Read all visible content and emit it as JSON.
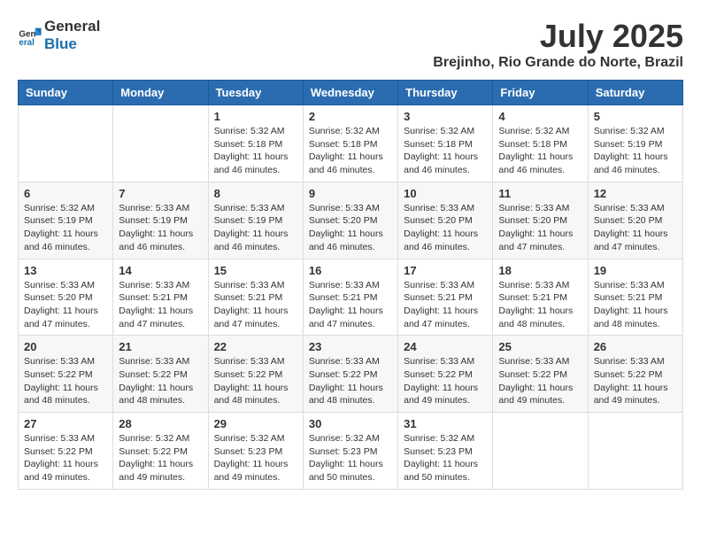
{
  "header": {
    "logo_general": "General",
    "logo_blue": "Blue",
    "title": "July 2025",
    "subtitle": "Brejinho, Rio Grande do Norte, Brazil"
  },
  "days_of_week": [
    "Sunday",
    "Monday",
    "Tuesday",
    "Wednesday",
    "Thursday",
    "Friday",
    "Saturday"
  ],
  "weeks": [
    [
      {
        "day": "",
        "info": ""
      },
      {
        "day": "",
        "info": ""
      },
      {
        "day": "1",
        "info": "Sunrise: 5:32 AM\nSunset: 5:18 PM\nDaylight: 11 hours and 46 minutes."
      },
      {
        "day": "2",
        "info": "Sunrise: 5:32 AM\nSunset: 5:18 PM\nDaylight: 11 hours and 46 minutes."
      },
      {
        "day": "3",
        "info": "Sunrise: 5:32 AM\nSunset: 5:18 PM\nDaylight: 11 hours and 46 minutes."
      },
      {
        "day": "4",
        "info": "Sunrise: 5:32 AM\nSunset: 5:18 PM\nDaylight: 11 hours and 46 minutes."
      },
      {
        "day": "5",
        "info": "Sunrise: 5:32 AM\nSunset: 5:19 PM\nDaylight: 11 hours and 46 minutes."
      }
    ],
    [
      {
        "day": "6",
        "info": "Sunrise: 5:32 AM\nSunset: 5:19 PM\nDaylight: 11 hours and 46 minutes."
      },
      {
        "day": "7",
        "info": "Sunrise: 5:33 AM\nSunset: 5:19 PM\nDaylight: 11 hours and 46 minutes."
      },
      {
        "day": "8",
        "info": "Sunrise: 5:33 AM\nSunset: 5:19 PM\nDaylight: 11 hours and 46 minutes."
      },
      {
        "day": "9",
        "info": "Sunrise: 5:33 AM\nSunset: 5:20 PM\nDaylight: 11 hours and 46 minutes."
      },
      {
        "day": "10",
        "info": "Sunrise: 5:33 AM\nSunset: 5:20 PM\nDaylight: 11 hours and 46 minutes."
      },
      {
        "day": "11",
        "info": "Sunrise: 5:33 AM\nSunset: 5:20 PM\nDaylight: 11 hours and 47 minutes."
      },
      {
        "day": "12",
        "info": "Sunrise: 5:33 AM\nSunset: 5:20 PM\nDaylight: 11 hours and 47 minutes."
      }
    ],
    [
      {
        "day": "13",
        "info": "Sunrise: 5:33 AM\nSunset: 5:20 PM\nDaylight: 11 hours and 47 minutes."
      },
      {
        "day": "14",
        "info": "Sunrise: 5:33 AM\nSunset: 5:21 PM\nDaylight: 11 hours and 47 minutes."
      },
      {
        "day": "15",
        "info": "Sunrise: 5:33 AM\nSunset: 5:21 PM\nDaylight: 11 hours and 47 minutes."
      },
      {
        "day": "16",
        "info": "Sunrise: 5:33 AM\nSunset: 5:21 PM\nDaylight: 11 hours and 47 minutes."
      },
      {
        "day": "17",
        "info": "Sunrise: 5:33 AM\nSunset: 5:21 PM\nDaylight: 11 hours and 47 minutes."
      },
      {
        "day": "18",
        "info": "Sunrise: 5:33 AM\nSunset: 5:21 PM\nDaylight: 11 hours and 48 minutes."
      },
      {
        "day": "19",
        "info": "Sunrise: 5:33 AM\nSunset: 5:21 PM\nDaylight: 11 hours and 48 minutes."
      }
    ],
    [
      {
        "day": "20",
        "info": "Sunrise: 5:33 AM\nSunset: 5:22 PM\nDaylight: 11 hours and 48 minutes."
      },
      {
        "day": "21",
        "info": "Sunrise: 5:33 AM\nSunset: 5:22 PM\nDaylight: 11 hours and 48 minutes."
      },
      {
        "day": "22",
        "info": "Sunrise: 5:33 AM\nSunset: 5:22 PM\nDaylight: 11 hours and 48 minutes."
      },
      {
        "day": "23",
        "info": "Sunrise: 5:33 AM\nSunset: 5:22 PM\nDaylight: 11 hours and 48 minutes."
      },
      {
        "day": "24",
        "info": "Sunrise: 5:33 AM\nSunset: 5:22 PM\nDaylight: 11 hours and 49 minutes."
      },
      {
        "day": "25",
        "info": "Sunrise: 5:33 AM\nSunset: 5:22 PM\nDaylight: 11 hours and 49 minutes."
      },
      {
        "day": "26",
        "info": "Sunrise: 5:33 AM\nSunset: 5:22 PM\nDaylight: 11 hours and 49 minutes."
      }
    ],
    [
      {
        "day": "27",
        "info": "Sunrise: 5:33 AM\nSunset: 5:22 PM\nDaylight: 11 hours and 49 minutes."
      },
      {
        "day": "28",
        "info": "Sunrise: 5:32 AM\nSunset: 5:22 PM\nDaylight: 11 hours and 49 minutes."
      },
      {
        "day": "29",
        "info": "Sunrise: 5:32 AM\nSunset: 5:23 PM\nDaylight: 11 hours and 49 minutes."
      },
      {
        "day": "30",
        "info": "Sunrise: 5:32 AM\nSunset: 5:23 PM\nDaylight: 11 hours and 50 minutes."
      },
      {
        "day": "31",
        "info": "Sunrise: 5:32 AM\nSunset: 5:23 PM\nDaylight: 11 hours and 50 minutes."
      },
      {
        "day": "",
        "info": ""
      },
      {
        "day": "",
        "info": ""
      }
    ]
  ]
}
